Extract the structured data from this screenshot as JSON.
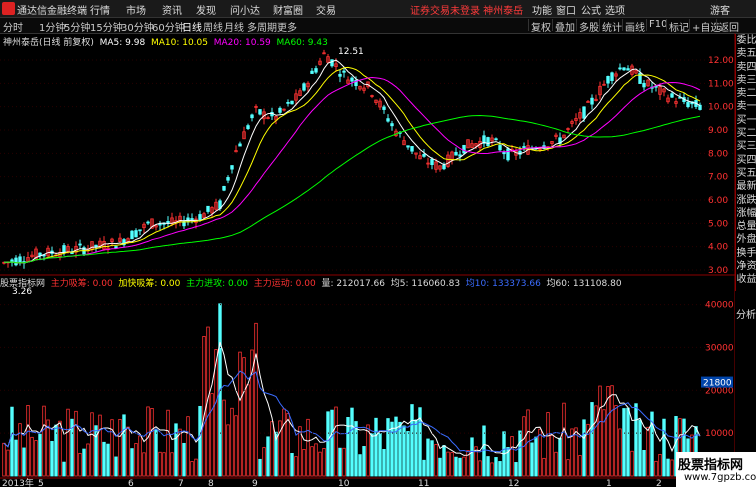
{
  "menubar": {
    "app_title": "通达信金融终端",
    "menus": [
      "行情",
      "市场",
      "资讯",
      "发现",
      "问小达",
      "财富圈",
      "交易"
    ],
    "notice": "证券交易未登录  神州泰岳",
    "right_menus": [
      "功能",
      "窗口",
      "公式",
      "选项",
      "游客"
    ]
  },
  "periodbar": {
    "periods": [
      "分时",
      "1分钟",
      "5分钟",
      "15分钟",
      "30分钟",
      "60分钟",
      "日线",
      "周线",
      "月线",
      "多周期",
      "更多"
    ],
    "tools": [
      "复权",
      "叠加",
      "多股",
      "统计",
      "画线",
      "F10",
      "标记",
      "+自选",
      "返回"
    ]
  },
  "legend": {
    "stock": "神州泰岳(日线 前复权)",
    "ma5": "MA5: 9.98",
    "ma10": "MA10: 10.05",
    "ma20": "MA20: 10.59",
    "ma60": "MA60: 9.43"
  },
  "price_chart": {
    "high_label": "12.51",
    "low_label": "3.26",
    "yticks": [
      "12.00",
      "11.00",
      "10.00",
      "9.00",
      "8.00",
      "7.00",
      "6.00",
      "5.00",
      "4.00",
      "3.00"
    ]
  },
  "right_panel": [
    "委比",
    "卖五",
    "卖四",
    "卖三",
    "卖二",
    "卖一",
    "买一",
    "买二",
    "买三",
    "买四",
    "买五",
    "最新",
    "涨跌",
    "涨幅",
    "总量",
    "外盘",
    "换手",
    "净资",
    "收益"
  ],
  "indicator": {
    "name": "股票指标网",
    "zljc": "主力吸筹: 0.00",
    "jkjc": "加快吸筹: 0.00",
    "zljg": "主力进攻: 0.00",
    "zlyd": "主力运动: 0.00",
    "vol": "量: 212017.66",
    "ma5": "均5: 116060.83",
    "ma10": "均10: 133373.66",
    "ma60": "均60: 131108.80"
  },
  "volume_chart": {
    "yticks": [
      "40000",
      "30000",
      "20000",
      "10000"
    ],
    "marker": "21800"
  },
  "volume_panel_label": "分析",
  "xaxis": [
    "2013年",
    "5",
    "6",
    "7",
    "8",
    "9",
    "10",
    "11",
    "12",
    "1",
    "2"
  ],
  "watermark": {
    "line1": "股票指标网",
    "line2": "www.7gpzb.com"
  },
  "colors": {
    "up": "#ff3232",
    "down": "#54ffff",
    "ma5": "#ffffff",
    "ma10": "#ffff00",
    "ma20": "#ff00ff",
    "ma60": "#00ff00"
  }
}
